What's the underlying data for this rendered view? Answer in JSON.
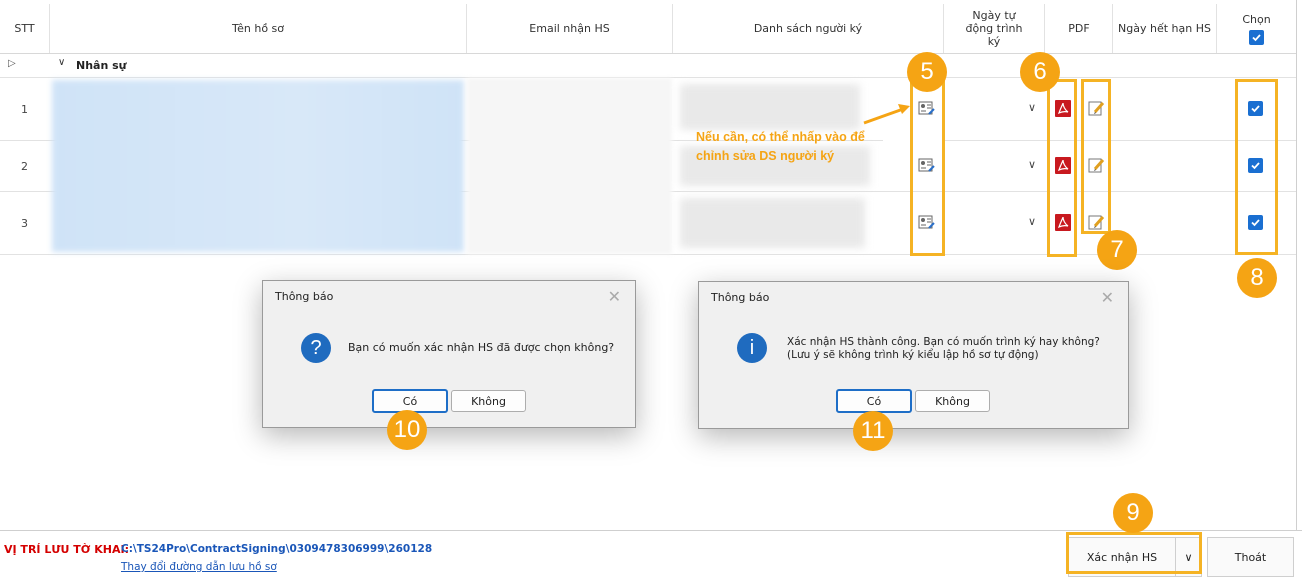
{
  "columns": {
    "stt": "STT",
    "ten_ho_so": "Tên hồ sơ",
    "email": "Email nhận HS",
    "nguoi_ky": "Danh sách người ký",
    "ngay_tu_dong": "Ngày tự động trình ký",
    "pdf": "PDF",
    "ngay_het_han": "Ngày hết hạn HS",
    "chon": "Chọn"
  },
  "group": {
    "label": "Nhân sự"
  },
  "rows": [
    {
      "stt": "1"
    },
    {
      "stt": "2"
    },
    {
      "stt": "3"
    }
  ],
  "annotation": {
    "line1": "Nếu cần, có thể nhấp vào để",
    "line2": "chỉnh sửa DS người ký"
  },
  "badges": [
    "5",
    "6",
    "7",
    "8",
    "9",
    "10",
    "11"
  ],
  "dialog1": {
    "title": "Thông báo",
    "message": "Bạn có muốn xác nhận HS đã được chọn không?",
    "yes": "Có",
    "no": "Không"
  },
  "dialog2": {
    "title": "Thông báo",
    "line1": "Xác nhận HS thành công. Bạn có muốn trình ký hay không?",
    "line2": "(Lưu ý sẽ không trình ký kiểu lập hồ sơ tự động)",
    "yes": "Có",
    "no": "Không"
  },
  "footer": {
    "label": "VỊ TRÍ LƯU TỜ KHAI:",
    "path": "C:\\TS24Pro\\ContractSigning\\0309478306999\\260128",
    "change_link": "Thay đổi đường dẫn lưu hồ sơ",
    "confirm_button": "Xác nhận HS",
    "exit_button": "Thoát"
  },
  "colors": {
    "accent": "#f5a414",
    "check": "#1a6fd1",
    "footer_label": "#d40000",
    "link": "#1a56b8"
  }
}
